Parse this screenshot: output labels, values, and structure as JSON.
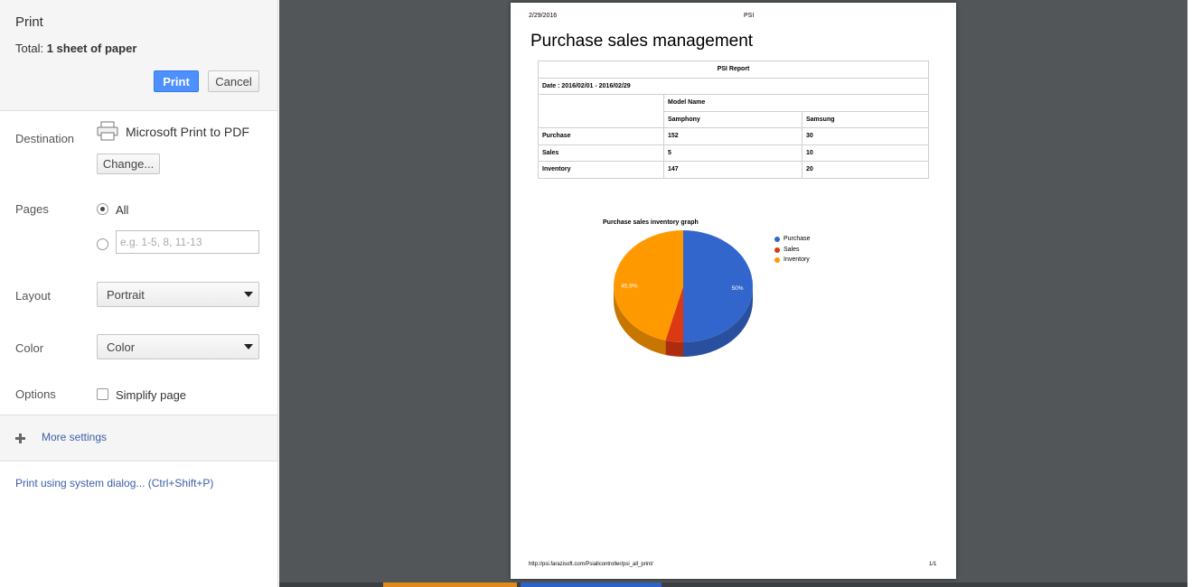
{
  "sidebar": {
    "title": "Print",
    "total_label": "Total: ",
    "total_value": "1 sheet of paper",
    "print_button": "Print",
    "cancel_button": "Cancel",
    "destination": {
      "label": "Destination",
      "name": "Microsoft Print to PDF",
      "change_button": "Change..."
    },
    "pages": {
      "label": "Pages",
      "all_label": "All",
      "range_placeholder": "e.g. 1-5, 8, 11-13",
      "selected": "All"
    },
    "layout": {
      "label": "Layout",
      "value": "Portrait"
    },
    "color": {
      "label": "Color",
      "value": "Color"
    },
    "options": {
      "label": "Options",
      "simplify_label": "Simplify page",
      "simplify_checked": false
    },
    "more_settings": "More settings",
    "system_dialog": "Print using system dialog... (Ctrl+Shift+P)"
  },
  "preview": {
    "header_date": "2/29/2016",
    "header_title": "PSI",
    "page_title": "Purchase sales management",
    "table": {
      "report_title": "PSI Report",
      "date_range": "Date : 2016/02/01 - 2016/02/29",
      "model_header": "Model Name",
      "models": [
        "Samphony",
        "Samsung"
      ],
      "rows": [
        {
          "label": "Purchase",
          "values": [
            "152",
            "30"
          ]
        },
        {
          "label": "Sales",
          "values": [
            "5",
            "10"
          ]
        },
        {
          "label": "Inventory",
          "values": [
            "147",
            "20"
          ]
        }
      ]
    },
    "footer_url": "http://psi.farazisoft.com/Psiallcontroller/psi_all_print/",
    "footer_page": "1/1"
  },
  "chart_data": {
    "type": "pie",
    "title": "Purchase sales inventory graph",
    "labels": [
      "Purchase",
      "Sales",
      "Inventory"
    ],
    "values": [
      50.0,
      4.1,
      45.9
    ],
    "data_labels": [
      "50%",
      "",
      "45.9%"
    ],
    "colors": [
      "#3366cc",
      "#dc3912",
      "#ff9900"
    ],
    "legend_position": "right",
    "three_d": true
  }
}
